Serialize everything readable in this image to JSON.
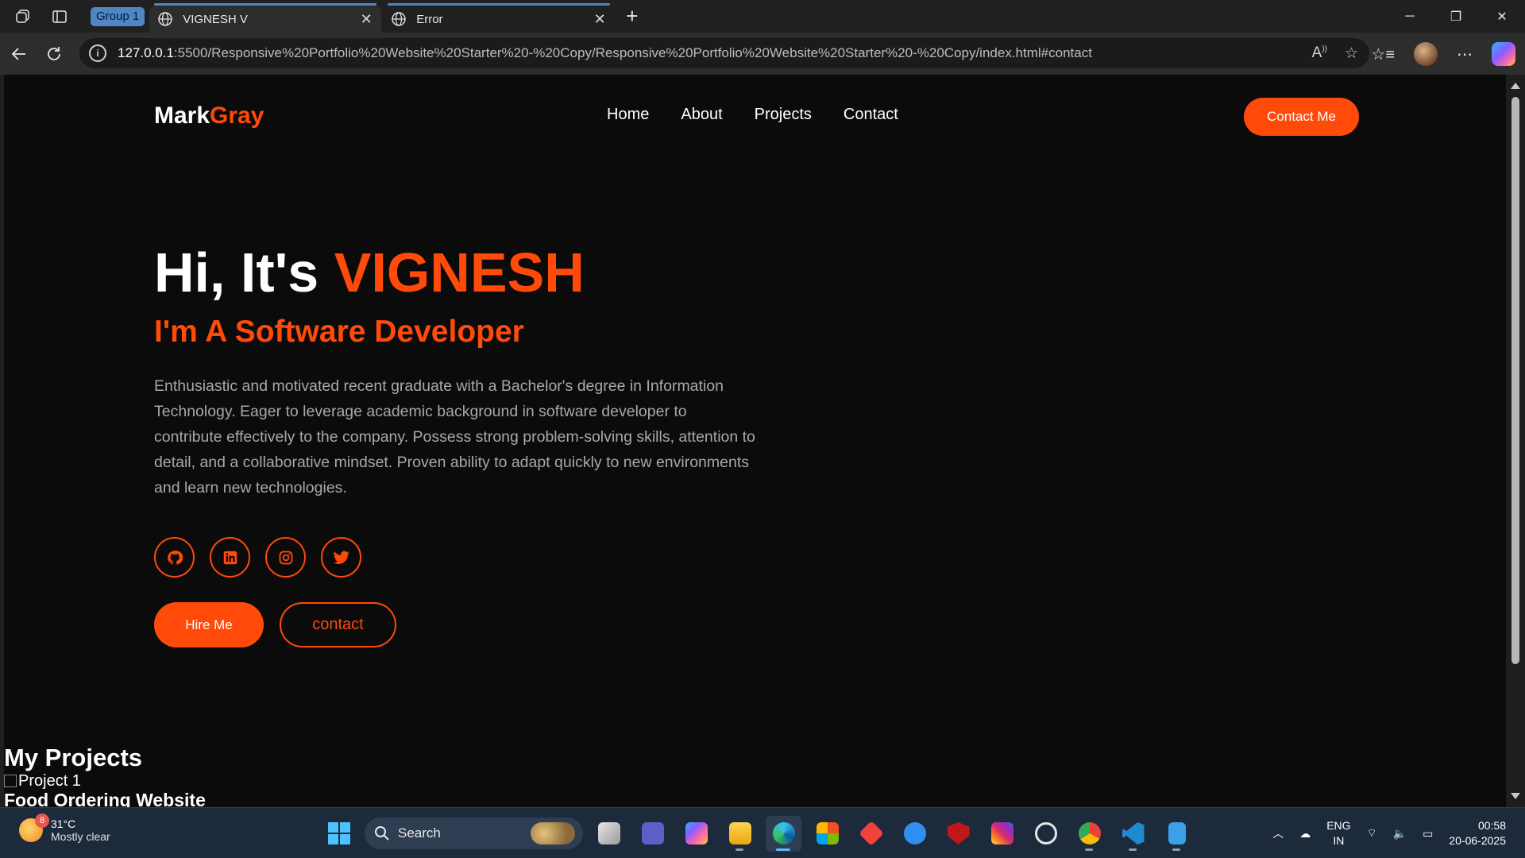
{
  "browser": {
    "group_label": "Group 1",
    "tabs": [
      {
        "title": "VIGNESH V",
        "active": true
      },
      {
        "title": "Error",
        "active": false
      }
    ],
    "url_host": "127.0.0.1",
    "url_rest": ":5500/Responsive%20Portfolio%20Website%20Starter%20-%20Copy/Responsive%20Portfolio%20Website%20Starter%20-%20Copy/index.html#contact",
    "window_controls": [
      "─",
      "❐",
      "✕"
    ]
  },
  "site": {
    "logo_main": "Mark",
    "logo_accent": "Gray",
    "nav": [
      "Home",
      "About",
      "Projects",
      "Contact"
    ],
    "cta_label": "Contact Me",
    "accent_color": "#ff4a0a",
    "hero": {
      "greeting": "Hi, It's ",
      "name": "VIGNESH",
      "subtitle": "I'm A Software Developer",
      "description": "Enthusiastic and motivated recent graduate with a Bachelor's degree in Information Technology. Eager to leverage academic background in software developer to contribute effectively to the company. Possess strong problem-solving skills, attention to detail, and a collaborative mindset. Proven ability to adapt quickly to new environments and learn new technologies.",
      "socials": [
        "github-icon",
        "linkedin-icon",
        "instagram-icon",
        "twitter-icon"
      ],
      "hire_label": "Hire Me",
      "contact_label": "contact"
    },
    "projects": {
      "heading": "My Projects",
      "image_alt": "Project 1",
      "first_title": "Food Ordering Website"
    }
  },
  "taskbar": {
    "weather_temp": "31°C",
    "weather_desc": "Mostly clear",
    "weather_badge": "8",
    "search_label": "Search",
    "lang_top": "ENG",
    "lang_bottom": "IN",
    "time": "00:58",
    "date": "20-06-2025"
  }
}
